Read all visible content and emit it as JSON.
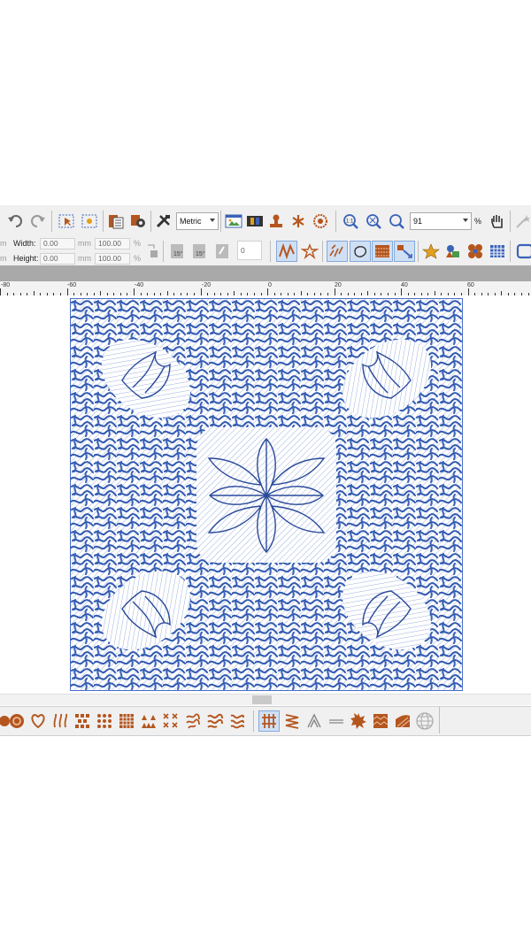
{
  "toolbar": {
    "units": "Metric",
    "zoom_value": "91",
    "zoom_unit": "%",
    "tools": [
      "undo-icon",
      "redo-icon",
      "select-icon",
      "select-point-icon",
      "pages-icon",
      "settings-gear-icon",
      "tools-icon",
      "picture-icon",
      "film-icon",
      "stamp-icon",
      "spiral-icon",
      "ring-icon",
      "zoom-1-1-icon",
      "zoom-fit-icon",
      "zoom-in-icon",
      "pan-hand-icon"
    ]
  },
  "properties": {
    "width_label": "Width:",
    "width_value": "0.00",
    "width_unit": "mm",
    "width_percent": "100.00",
    "height_label": "Height:",
    "height_value": "0.00",
    "height_unit": "mm",
    "height_percent": "100.00",
    "percent_sign": "%",
    "rotate_value": "0",
    "rotate_badge": "15°"
  },
  "ruler": {
    "labels": [
      "-80",
      "-60",
      "-40",
      "-20",
      "0",
      "20",
      "40",
      "60"
    ]
  },
  "colors": {
    "stitch_blue": "#3b63b8",
    "stitch_dark": "#1f3f8f",
    "icon_orange": "#b5561f",
    "toolbar_bg": "#f0f0f0"
  },
  "fill_tools": [
    "gear-fill-icon",
    "heart-fill-icon",
    "wave-fill-icon",
    "cross-fill-icon",
    "dots-fill-icon",
    "grid-fill-icon",
    "triangles-fill-icon",
    "x-fill-icon",
    "swirl-fill-icon",
    "swirl2-fill-icon",
    "swirl3-fill-icon",
    "satin-fill-icon",
    "zigzag-fill-icon",
    "angle-icon",
    "line-icon",
    "star-gear-icon",
    "wave2-fill-icon",
    "ribbon-fill-icon",
    "globe-icon"
  ]
}
